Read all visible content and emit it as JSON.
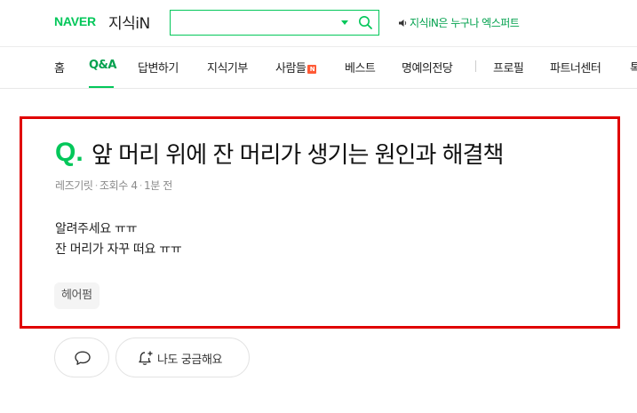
{
  "header": {
    "brand": "NAVER",
    "service": "지식iN",
    "search_placeholder": "",
    "notice": "지식iN은 누구나 엑스퍼트"
  },
  "nav": {
    "items": [
      {
        "label": "홈"
      },
      {
        "label": "Q&A"
      },
      {
        "label": "답변하기"
      },
      {
        "label": "지식기부"
      },
      {
        "label": "사람들",
        "badge": "N"
      },
      {
        "label": "베스트"
      },
      {
        "label": "명예의전당"
      },
      {
        "label": "프로필"
      },
      {
        "label": "파트너센터"
      },
      {
        "label": "톡"
      }
    ],
    "active": "Q&A"
  },
  "question": {
    "mark": "Q.",
    "title": "앞 머리 위에 잔 머리가 생기는 원인과 해결책",
    "author": "레즈기릿",
    "views": "조회수 4",
    "time": "1분 전",
    "body_lines": [
      "알려주세요 ㅠㅠ",
      "잔 머리가 자꾸 떠요 ㅠㅠ"
    ],
    "tag": "헤어펌"
  },
  "actions": {
    "curious_label": "나도 궁금해요"
  },
  "colors": {
    "brand_green": "#03c75a",
    "highlight_border": "#e00000",
    "badge": "#ff5a36"
  }
}
